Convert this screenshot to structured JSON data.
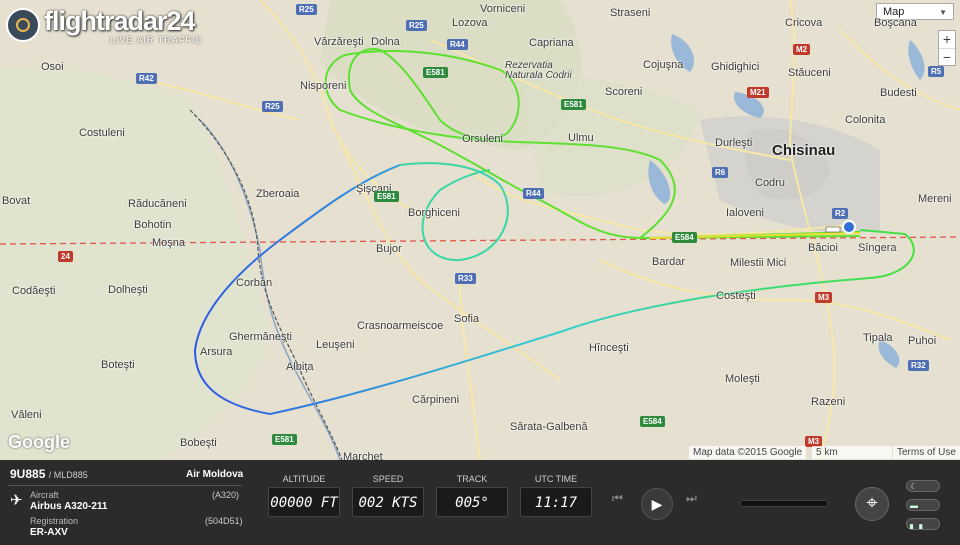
{
  "app": {
    "logo_text": "flightradar24",
    "logo_subtitle": "LIVE AIR TRAFFIC"
  },
  "map": {
    "type_select": "Map",
    "zoom_in": "+",
    "zoom_out": "−",
    "google_logo": "Google",
    "attribution": "Map data ©2015 Google",
    "scale": "5 km",
    "terms": "Terms of Use",
    "towns": {
      "vornicenii": "Vorniceni",
      "straseni": "Straseni",
      "cricova": "Cricova",
      "bosca": "Boşcana",
      "lozova": "Lozova",
      "varzaresti": "Vărzăreşti",
      "dolna": "Dolna",
      "capriana": "Capriana",
      "cojusna": "Cojuşna",
      "ghidighici": "Ghidighici",
      "stauceni": "Stăuceni",
      "osoi": "Osoi",
      "rezervatia": "Rezervatia Naturala Codrii",
      "nisporeni": "Nisporeni",
      "scoreni": "Scoreni",
      "budesti": "Budesti",
      "colonita": "Colonita",
      "costuleni": "Costuleni",
      "ulmu": "Ulmu",
      "ursuleni": "Orsuleni",
      "durlesti": "Durleşti",
      "chisinau": "Chisinau",
      "codru": "Codru",
      "zberoaia": "Zberoaia",
      "siscani": "Şişcani",
      "bovat": "Bovat",
      "raducaneni": "Răducăneni",
      "mereni": "Mereni",
      "bohotin": "Bohotin",
      "borghiceni": "Borghiceni",
      "ialoveni": "Ialoveni",
      "mosna": "Moşna",
      "bacioi": "Băcioi",
      "singera": "Sîngera",
      "bujor": "Bujor",
      "bardar": "Bardar",
      "milestii": "Milestii Mici",
      "codaesti": "Codăeşti",
      "dolhesti": "Dolheşti",
      "corban": "Corban",
      "costesti": "Costeşti",
      "sofia": "Sofia",
      "crasnoarmeiscoe": "Crasnoarmeiscoe",
      "germanesti": "Ghermăneşti",
      "leuseni": "Leuşeni",
      "hincesti": "Hînceşti",
      "tipala": "Tipala",
      "puhoi": "Puhoi",
      "arsura": "Arsura",
      "botesti": "Boteşti",
      "albita": "Albiţa",
      "molesti": "Moleşti",
      "valeni": "Văleni",
      "carpineni": "Cărpineni",
      "razeni": "Razeni",
      "sarata": "Sărata-Galbenă",
      "bobesti": "Bobeşti",
      "marchet": "Marchet"
    },
    "roads": {
      "r25a": "R25",
      "r25b": "R25",
      "r25c": "R25",
      "r44a": "R44",
      "r44b": "R44",
      "r42": "R42",
      "e581a": "E581",
      "e581b": "E581",
      "e581c": "E581",
      "e581d": "E581",
      "e584a": "E584",
      "e584b": "E584",
      "r33": "R33",
      "r6": "R6",
      "m21": "M21",
      "m2": "M2",
      "m3": "M3",
      "m3b": "M3",
      "r32": "R32",
      "r5": "R5",
      "r2": "R2",
      "r24": "24"
    }
  },
  "flight": {
    "callsign": "9U885",
    "icao_callsign": "MLD885",
    "airline": "Air Moldova",
    "aircraft_label": "Aircraft",
    "aircraft": "Airbus A320-211",
    "aircraft_code": "(A320)",
    "registration_label": "Registration",
    "registration": "ER-AXV",
    "mode_s": "(504D51)"
  },
  "gauges": {
    "altitude_label": "ALTITUDE",
    "altitude": "00000 FT",
    "speed_label": "SPEED",
    "speed": "002 KTS",
    "track_label": "TRACK",
    "track": "005°",
    "utc_label": "UTC TIME",
    "utc": "11:17"
  },
  "playback": {
    "rewind": "⏮",
    "play": "▶",
    "forward": "⏭"
  },
  "colors": {
    "track_low": "#2f57e6",
    "track_mid": "#33d0d0",
    "track_high": "#44e23a",
    "panel_bg": "#2b2b2b",
    "border_dashed": "#e0584b"
  }
}
